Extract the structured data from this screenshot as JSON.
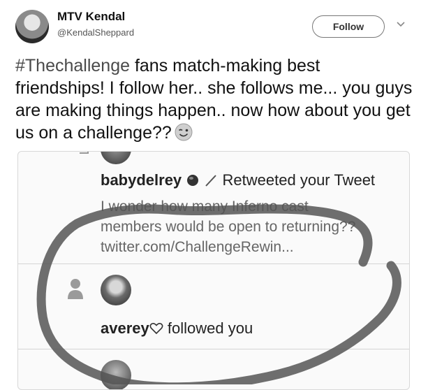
{
  "author": {
    "display_name": "MTV Kendal",
    "handle": "@KendalSheppard",
    "follow_label": "Follow"
  },
  "tweet": {
    "hashtag": "#Thechallenge",
    "body": " fans match-making best friendships! I follow her..  she follows me... you guys are making things happen.. now how about you get us on a challenge??"
  },
  "notifications": [
    {
      "username": "babydelrey",
      "action": "Retweeted your Tweet",
      "quote_line1": "I wonder how many Inferno cast",
      "quote_line2": "members would be open to returning??",
      "quote_link": "twitter.com/ChallengeRewin..."
    },
    {
      "username": "averey",
      "action": "followed you"
    }
  ],
  "icons": {
    "more": "chevron-down-icon",
    "follow_notification": "person-icon",
    "emoji": "winking-face-icon"
  }
}
